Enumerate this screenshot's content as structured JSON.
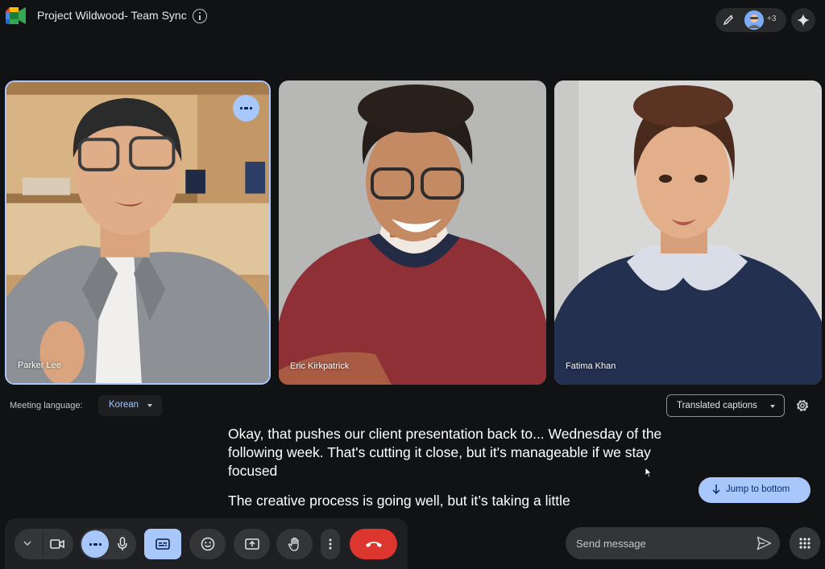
{
  "meeting": {
    "title": "Project Wildwood- Team Sync",
    "extra_participants": "+3"
  },
  "participants": [
    {
      "name": "Parker Lee",
      "speaking": true
    },
    {
      "name": "Eric Kirkpatrick",
      "speaking": false
    },
    {
      "name": "Fatima Khan",
      "speaking": false
    }
  ],
  "language": {
    "label": "Meeting language:",
    "value": "Korean"
  },
  "captions_mode": {
    "value": "Translated captions"
  },
  "captions": [
    "Okay, that pushes our client presentation back to... Wednesday of the following week. That's cutting it close, but it's manageable if we stay focused",
    "The creative process is going well, but it’s taking a little"
  ],
  "jump_button": {
    "label": "Jump to bottom"
  },
  "chat": {
    "placeholder": "Send message"
  },
  "colors": {
    "background": "#111214",
    "accent": "#a8c7fa",
    "end_call": "#dc362e",
    "control_bg": "#333537"
  },
  "icons": {
    "logo": "google-meet-logo",
    "info": "info-icon",
    "pen": "pen-icon",
    "spark": "spark-icon",
    "settings": "gear-icon",
    "camera": "camera-icon",
    "mic": "mic-icon",
    "captions": "closed-captions-icon",
    "emoji": "emoji-icon",
    "present": "present-icon",
    "hand": "raise-hand-icon",
    "more": "more-vert-icon",
    "end": "end-call-icon",
    "send": "send-icon",
    "apps": "apps-grid-icon"
  }
}
